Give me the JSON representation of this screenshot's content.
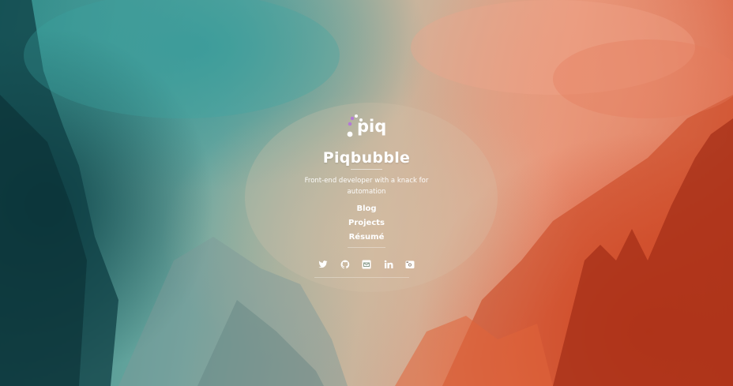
{
  "brand": {
    "logo_text": "piq",
    "name": "Piqbubble",
    "tagline": "Front-end developer with a knack for automation"
  },
  "nav": {
    "items": [
      {
        "label": "Blog"
      },
      {
        "label": "Projects"
      },
      {
        "label": "Résumé"
      }
    ]
  },
  "social": {
    "icons": [
      "twitter-icon",
      "github-icon",
      "email-icon",
      "linkedin-icon",
      "camera-icon"
    ]
  },
  "colors": {
    "logo_accent": "#b37ad6",
    "text": "#ffffff",
    "bg_teal": "#2e8a88",
    "bg_orange": "#d85a3a"
  }
}
